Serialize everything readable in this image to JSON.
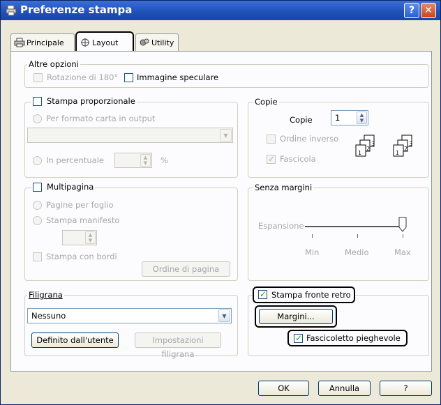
{
  "window": {
    "title": "Preferenze stampa",
    "help_btn": "?",
    "close_btn": "✕"
  },
  "tabs": [
    {
      "label": "Principale"
    },
    {
      "label": "Layout"
    },
    {
      "label": "Utility"
    }
  ],
  "altre_opzioni": {
    "title": "Altre opzioni",
    "rotazione": {
      "label": "Rotazione di 180°",
      "checked": false,
      "enabled": false
    },
    "speculare": {
      "label": "Immagine speculare",
      "checked": false
    }
  },
  "proporzionale": {
    "label": "Stampa proporzionale",
    "checked": false,
    "per_formato": "Per formato carta in output",
    "formato_value": "",
    "percentuale": "In percentuale",
    "percent_value": "",
    "percent_unit": "%"
  },
  "copie": {
    "title": "Copie",
    "label": "Copie",
    "value": "1",
    "ordine_inverso": "Ordine inverso",
    "fascicola": "Fascicola",
    "fascicola_checked": true
  },
  "multipagina": {
    "label": "Multipagina",
    "checked": false,
    "pagine_per_foglio": "Pagine per foglio",
    "stampa_manifesto": "Stampa manifesto",
    "manifesto_value": "",
    "stampa_con_bordi": "Stampa con bordi",
    "ordine_pagina": "Ordine di pagina"
  },
  "senza_margini": {
    "title": "Senza margini",
    "espansione": "Espansione",
    "min": "Min",
    "medio": "Medio",
    "max": "Max",
    "level": "Max"
  },
  "filigrana": {
    "title": "Filigrana",
    "value": "Nessuno",
    "definito": "Definito dall'utente",
    "impostazioni": "Impostazioni filigrana"
  },
  "fronte_retro": {
    "label": "Stampa fronte retro",
    "checked": true,
    "margini": "Margini...",
    "fascicoletto": "Fascicoletto pieghevole",
    "fascicoletto_checked": true
  },
  "buttons": {
    "ok": "OK",
    "annulla": "Annulla",
    "help": "?"
  },
  "colors": {
    "titlebar": "#1f4fb8",
    "check": "#21a121",
    "disabled_text": "#a7a6aa"
  }
}
